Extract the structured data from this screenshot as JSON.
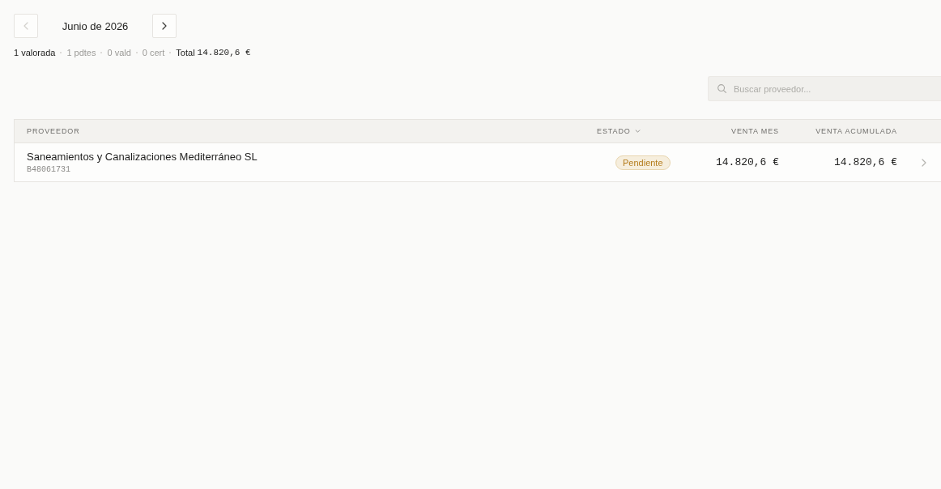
{
  "month_nav": {
    "previous": {
      "disabled": true
    },
    "title": "Junio de 2026",
    "next": {
      "disabled": false
    }
  },
  "summary": {
    "stats": [
      {
        "text": "1 valorada",
        "emphasis": true
      },
      {
        "text": "1 pdtes",
        "emphasis": false
      },
      {
        "text": "0 vald",
        "emphasis": false
      },
      {
        "text": "0 cert",
        "emphasis": false
      }
    ],
    "total": {
      "label": "Total",
      "value": "14.820,6 €"
    }
  },
  "search": {
    "placeholder": "Buscar proveedor..."
  },
  "table": {
    "columns": [
      {
        "label": "PROVEEDOR",
        "sortable": false
      },
      {
        "label": "ESTADO",
        "sortable": true
      },
      {
        "label": "VENTA MES",
        "sortable": false
      },
      {
        "label": "VENTA ACUMULADA",
        "sortable": false
      }
    ],
    "rows": [
      {
        "name": "Saneamientos y Canalizaciones Mediterráneo SL",
        "tax_id": "B48061731",
        "status": {
          "label": "Pendiente",
          "kind": "pending"
        },
        "venta_mes": "14.820,6 €",
        "venta_acumulada": "14.820,6 €"
      }
    ]
  }
}
